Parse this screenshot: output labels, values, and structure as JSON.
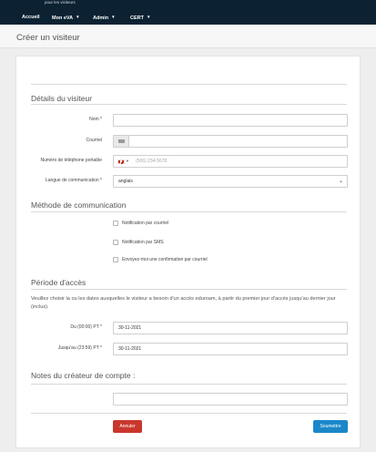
{
  "header": {
    "brand_subtitle": "pour les visiteurs",
    "nav": [
      {
        "label": "Accueil",
        "has_menu": false
      },
      {
        "label": "Mon eVA",
        "has_menu": true
      },
      {
        "label": "Admin",
        "has_menu": true
      },
      {
        "label": "CERT",
        "has_menu": true
      }
    ]
  },
  "page": {
    "title": "Créer un visiteur"
  },
  "visitor": {
    "section_title": "Détails du visiteur",
    "name_label": "Nom *",
    "email_label": "Courriel",
    "phone_label": "Numéro de téléphone portable",
    "phone_placeholder": "(506) 234-5678",
    "language_label": "Langue de communication *",
    "language_value": "anglais"
  },
  "communication": {
    "section_title": "Méthode de communication",
    "options": [
      {
        "label": "Notification par courriel",
        "checked": false
      },
      {
        "label": "Notification par SMS",
        "checked": false
      },
      {
        "label": "Envoyez-moi une confirmation par courriel",
        "checked": false
      }
    ]
  },
  "access": {
    "section_title": "Période d'accès",
    "description": "Veuillez choisir la ou les dates auxquelles le visiteur a besoin d'un accès eduroam, à partir du premier jour d'accès jusqu'au dernier jour (inclus).",
    "from_label": "Du (00:00) PT *",
    "from_value": "30-11-2021",
    "to_label": "Jusqu'au (23:59) PT *",
    "to_value": "30-11-2021"
  },
  "notes": {
    "section_title": "Notes du créateur de compte :"
  },
  "actions": {
    "cancel_label": "Annuler",
    "submit_label": "Soumettre"
  },
  "colors": {
    "topbar": "#0c2233",
    "cancel": "#c9372c",
    "submit": "#1a87c9"
  }
}
